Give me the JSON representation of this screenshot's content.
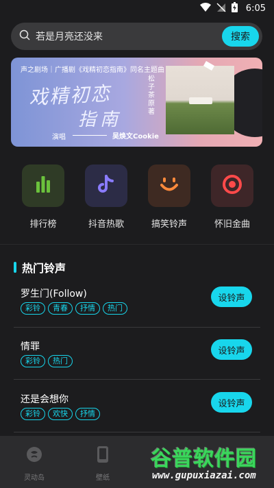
{
  "status_bar": {
    "time": "6:05"
  },
  "search": {
    "placeholder_text": "若是月亮还没来",
    "button_label": "搜索"
  },
  "banner": {
    "top_line": "声之剧场｜广播剧《戏精初恋指南》同名主题曲",
    "calligraphy_line1": "戏精初恋",
    "calligraphy_line2": "指南",
    "author": "松子茶 原著",
    "singer_label": "演唱",
    "singer": "吴焕文Cookie"
  },
  "shortcuts": [
    {
      "label": "排行榜",
      "icon": "chart-bars-icon",
      "tile_color": "#2f3b26",
      "icon_color": "#6bc23c"
    },
    {
      "label": "抖音热歌",
      "icon": "tiktok-note-icon",
      "tile_color": "#2c2c46",
      "icon_color": "#8a7cff"
    },
    {
      "label": "搞笑铃声",
      "icon": "smile-face-icon",
      "tile_color": "#3e2a22",
      "icon_color": "#ff8a3c"
    },
    {
      "label": "怀旧金曲",
      "icon": "target-record-icon",
      "tile_color": "#3e2628",
      "icon_color": "#ff4a4a"
    }
  ],
  "hot_section": {
    "title": "热门铃声"
  },
  "songs": [
    {
      "name": "罗生门(Follow)",
      "tags": [
        "彩铃",
        "青春",
        "抒情",
        "热门"
      ],
      "button": "设铃声"
    },
    {
      "name": "情罪",
      "tags": [
        "彩铃",
        "热门"
      ],
      "button": "设铃声"
    },
    {
      "name": "还是会想你",
      "tags": [
        "彩铃",
        "欢快",
        "抒情"
      ],
      "button": "设铃声"
    }
  ],
  "bottom_nav": [
    {
      "label": "灵动岛",
      "icon": "island-icon"
    },
    {
      "label": "壁纸",
      "icon": "phone-icon"
    }
  ],
  "watermark": {
    "big": "谷普软件园",
    "small": "www.gupuxiazai.com"
  },
  "colors": {
    "accent": "#18d6ec",
    "background": "#1c1c1e"
  }
}
